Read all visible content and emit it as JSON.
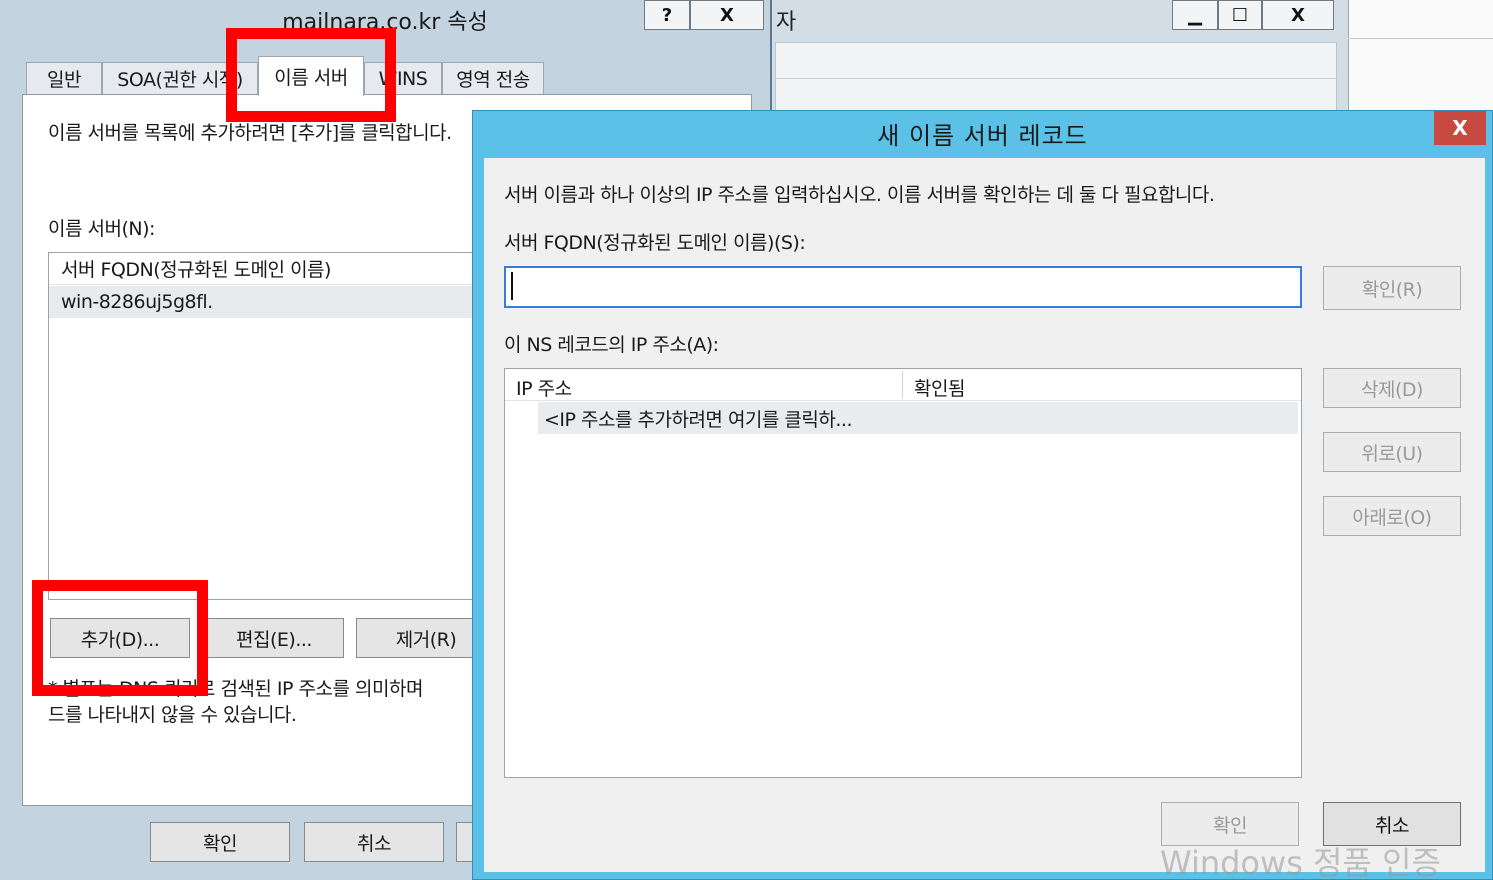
{
  "background_window": {
    "title_fragment": "자",
    "minimize_label": "▁",
    "maximize_label": "☐",
    "close_label": "X"
  },
  "properties_dialog": {
    "title": "mailnara.co.kr 속성",
    "help_label": "?",
    "close_label": "X",
    "tabs": [
      {
        "label": "일반"
      },
      {
        "label": "SOA(권한 시작)"
      },
      {
        "label": "이름 서버"
      },
      {
        "label": "WINS"
      },
      {
        "label": "영역 전송"
      }
    ],
    "active_tab": "이름 서버",
    "instruction": "이름 서버를 목록에 추가하려면 [추가]를 클릭합니다.",
    "list_label": "이름 서버(N):",
    "list_header": "서버 FQDN(정규화된 도메인 이름)",
    "list_rows": [
      "win-8286uj5g8fl."
    ],
    "add_label": "추가(D)...",
    "edit_label": "편집(E)...",
    "remove_label": "제거(R)",
    "note_line1": "* 별표는 DNS 쿼리로 검색된 IP 주소를 의미하며",
    "note_line2": "드를 나타내지 않을 수 있습니다.",
    "ok_label": "확인",
    "cancel_label": "취소"
  },
  "ns_dialog": {
    "title": "새 이름 서버 레코드",
    "close_label": "X",
    "description": "서버 이름과 하나 이상의 IP 주소를 입력하십시오. 이름 서버를 확인하는 데 둘 다 필요합니다.",
    "fqdn_label": "서버 FQDN(정규화된 도메인 이름)(S):",
    "fqdn_value": "",
    "resolve_label": "확인(R)",
    "ip_label": "이 NS 레코드의 IP 주소(A):",
    "ip_columns": [
      "IP 주소",
      "확인됨"
    ],
    "ip_placeholder_row": "<IP 주소를 추가하려면 여기를 클릭하...",
    "delete_label": "삭제(D)",
    "up_label": "위로(U)",
    "down_label": "아래로(O)",
    "ok_label": "확인",
    "cancel_label": "취소"
  },
  "watermark": "Windows 정품 인증",
  "colors": {
    "highlight": "#ff0000",
    "dialog_frame": "#5bc1e6",
    "close_button": "#c8493f"
  }
}
